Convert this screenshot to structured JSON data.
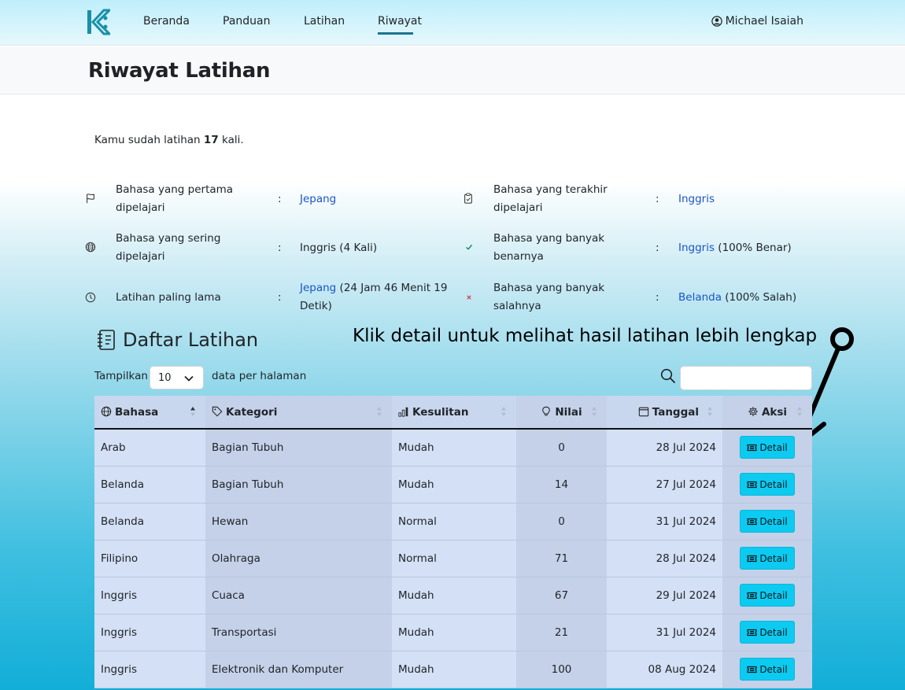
{
  "nav": {
    "links": [
      "Beranda",
      "Panduan",
      "Latihan",
      "Riwayat"
    ],
    "user": "Michael Isaiah"
  },
  "page": {
    "title": "Riwayat Latihan"
  },
  "summary": {
    "prefix": "Kamu sudah latihan ",
    "count": "17",
    "suffix": " kali."
  },
  "stats": {
    "first_label": "Bahasa yang pertama dipelajari",
    "first_value": "Jepang",
    "last_label": "Bahasa yang terakhir dipelajari",
    "last_value": "Inggris",
    "frequent_label": "Bahasa yang sering dipelajari",
    "frequent_value": "Inggris (4 Kali)",
    "most_correct_label": "Bahasa yang banyak benarnya",
    "most_correct_value": "Inggris",
    "most_correct_note": " (100% Benar)",
    "longest_label": "Latihan paling lama",
    "longest_value": "Jepang",
    "longest_note": " (24 Jam 46 Menit 19 Detik)",
    "most_wrong_label": "Bahasa yang banyak salahnya",
    "most_wrong_value": "Belanda",
    "most_wrong_note": " (100% Salah)",
    "colon": ":"
  },
  "list": {
    "title": "Daftar Latihan",
    "annotation": "Klik detail untuk melihat hasil latihan lebih lengkap",
    "show_label": "Tampilkan",
    "page_size": "10",
    "per_page_label": "data per halaman",
    "search_placeholder": ""
  },
  "table": {
    "headers": [
      "Bahasa",
      "Kategori",
      "Kesulitan",
      "Nilai",
      "Tanggal",
      "Aksi"
    ],
    "detail_label": "Detail",
    "rows": [
      [
        "Arab",
        "Bagian Tubuh",
        "Mudah",
        "0",
        "28 Jul 2024"
      ],
      [
        "Belanda",
        "Bagian Tubuh",
        "Mudah",
        "14",
        "27 Jul 2024"
      ],
      [
        "Belanda",
        "Hewan",
        "Normal",
        "0",
        "31 Jul 2024"
      ],
      [
        "Filipino",
        "Olahraga",
        "Normal",
        "71",
        "28 Jul 2024"
      ],
      [
        "Inggris",
        "Cuaca",
        "Mudah",
        "67",
        "29 Jul 2024"
      ],
      [
        "Inggris",
        "Transportasi",
        "Mudah",
        "21",
        "31 Jul 2024"
      ],
      [
        "Inggris",
        "Elektronik dan Komputer",
        "Mudah",
        "100",
        "08 Aug 2024"
      ]
    ]
  },
  "colors": {
    "accent": "#0dcaf0",
    "link": "#1a55c7",
    "nav_active": "#1c7490"
  },
  "icons": [
    "user-circle-icon",
    "flag-icon",
    "clipboard-icon",
    "globe-icon",
    "check-icon",
    "clock-icon",
    "x-icon",
    "notebook-icon",
    "search-icon",
    "tag-icon",
    "signal-icon",
    "lightbulb-icon",
    "calendar-icon",
    "gear-icon",
    "ticket-icon",
    "chevron-down-icon",
    "sort-icon"
  ]
}
